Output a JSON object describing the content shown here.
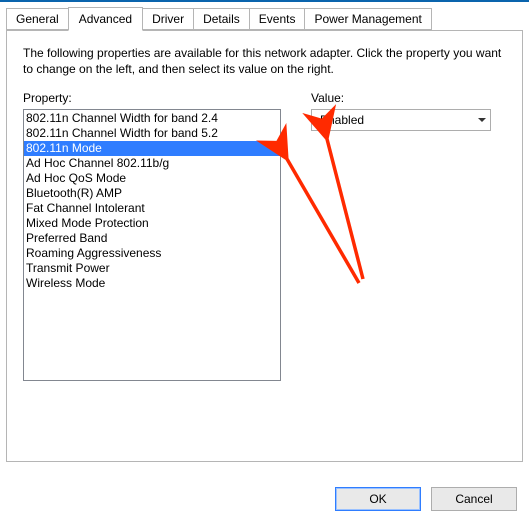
{
  "tabs": {
    "general": "General",
    "advanced": "Advanced",
    "driver": "Driver",
    "details": "Details",
    "events": "Events",
    "power": "Power Management"
  },
  "active_tab": "advanced",
  "description": "The following properties are available for this network adapter. Click the property you want to change on the left, and then select its value on the right.",
  "property_label": "Property:",
  "value_label": "Value:",
  "properties": [
    "802.11n Channel Width for band 2.4",
    "802.11n Channel Width for band 5.2",
    "802.11n Mode",
    "Ad Hoc Channel 802.11b/g",
    "Ad Hoc QoS Mode",
    "Bluetooth(R) AMP",
    "Fat Channel Intolerant",
    "Mixed Mode Protection",
    "Preferred Band",
    "Roaming Aggressiveness",
    "Transmit Power",
    "Wireless Mode"
  ],
  "selected_property_index": 2,
  "value_selected": "Enabled",
  "buttons": {
    "ok": "OK",
    "cancel": "Cancel"
  },
  "annotation_color": "#ff2a00"
}
